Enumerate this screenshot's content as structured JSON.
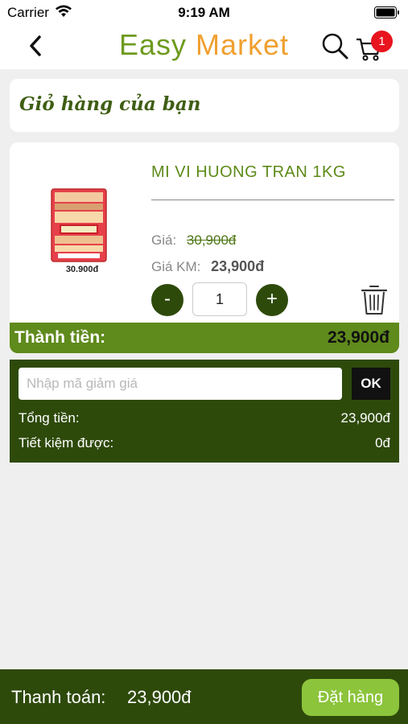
{
  "status_bar": {
    "carrier": "Carrier",
    "time": "9:19 AM"
  },
  "nav": {
    "title_part1": "Easy",
    "title_part2": "Market",
    "cart_count": "1",
    "icons": {
      "back": "chevron-left-icon",
      "search": "search-icon",
      "cart": "cart-icon"
    }
  },
  "cart": {
    "heading": "Giỏ hàng của bạn",
    "items": [
      {
        "name": "MI VI HUONG TRAN 1KG",
        "image_price": "30.900đ",
        "price_label": "Giá:",
        "original_price": "30,900đ",
        "sale_label": "Giá KM:",
        "sale_price": "23,900đ",
        "quantity": "1",
        "minus_label": "-",
        "plus_label": "+",
        "subtotal_label": "Thành tiền:",
        "subtotal_value": "23,900đ"
      }
    ]
  },
  "coupon": {
    "placeholder": "Nhập mã giảm giá",
    "ok_label": "OK",
    "total_label": "Tổng tiền:",
    "total_value": "23,900đ",
    "saving_label": "Tiết kiệm được:",
    "saving_value": "0đ"
  },
  "checkout": {
    "pay_label": "Thanh toán:",
    "pay_value": "23,900đ",
    "order_button": "Đặt hàng"
  },
  "colors": {
    "brand_green": "#6e9a1e",
    "brand_orange": "#f0a030",
    "dark_green": "#2e4a0b",
    "mid_green": "#5f8a1c",
    "button_green": "#8cc43c",
    "badge_red": "#e8141e"
  }
}
